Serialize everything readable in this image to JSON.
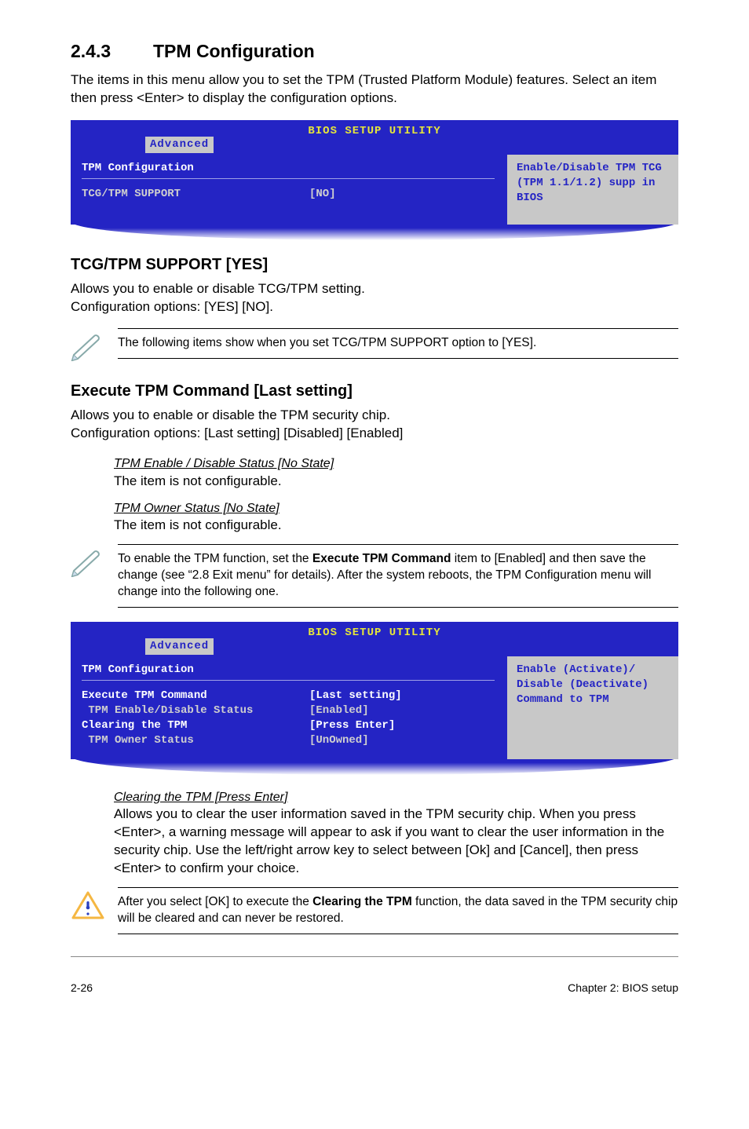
{
  "section": {
    "number": "2.4.3",
    "title": "TPM Configuration"
  },
  "intro": "The items in this menu allow you to set the TPM (Trusted Platform Module) features. Select an item then press <Enter> to display the configuration options.",
  "bios1": {
    "title": "BIOS SETUP UTILITY",
    "tab": "Advanced",
    "cfg_title": "TPM Configuration",
    "row1_label": "TCG/TPM SUPPORT",
    "row1_value": "[NO]",
    "help": "Enable/Disable TPM TCG (TPM 1.1/1.2) supp in BIOS"
  },
  "tcg": {
    "heading": "TCG/TPM SUPPORT [YES]",
    "line1": "Allows you to enable or disable TCG/TPM setting.",
    "line2": "Configuration options: [YES] [NO]."
  },
  "note1": "The following items show when you set TCG/TPM SUPPORT option to [YES].",
  "exec": {
    "heading": "Execute TPM Command [Last setting]",
    "line1": "Allows you to enable or disable the TPM security chip.",
    "line2": "Configuration options: [Last setting] [Disabled] [Enabled]"
  },
  "sub1": {
    "title": "TPM Enable / Disable Status [No State]",
    "body": "The item is not configurable."
  },
  "sub2": {
    "title": "TPM Owner Status [No State]",
    "body": "The item is not configurable."
  },
  "note2a": "To enable the TPM function, set the ",
  "note2b": "Execute TPM Command",
  "note2c": " item to [Enabled] and then save the change (see “2.8 Exit menu” for details). After the system reboots, the TPM Configuration menu will change into the following one.",
  "bios2": {
    "title": "BIOS SETUP UTILITY",
    "tab": "Advanced",
    "cfg_title": "TPM Configuration",
    "r1l": "Execute TPM Command",
    "r1v": "[Last setting]",
    "r2l": " TPM Enable/Disable Status",
    "r2v": "[Enabled]",
    "r3l": "Clearing the TPM",
    "r3v": "[Press Enter]",
    "r4l": " TPM Owner Status",
    "r4v": "[UnOwned]",
    "help": "Enable (Activate)/ Disable (Deactivate) Command to TPM"
  },
  "clearing": {
    "title": "Clearing the TPM [Press Enter]",
    "body": "Allows you to clear the user information saved in the TPM security chip. When you press <Enter>, a warning message will appear to ask if you want to clear the user information in the security chip. Use the left/right arrow key to select between [Ok] and [Cancel], then press <Enter> to confirm your choice."
  },
  "note3a": "After you select [OK] to execute the ",
  "note3b": "Clearing the TPM",
  "note3c": " function, the data saved in the TPM security chip will be cleared and can never be restored.",
  "footer": {
    "left": "2-26",
    "right": "Chapter 2: BIOS setup"
  }
}
